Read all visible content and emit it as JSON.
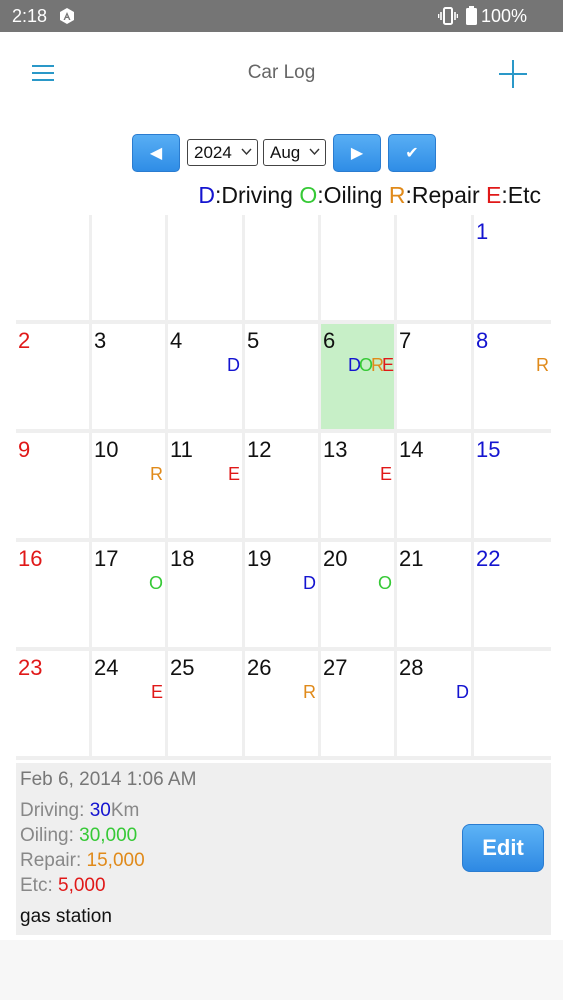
{
  "status_bar": {
    "time": "2:18",
    "battery": "100%"
  },
  "app_bar": {
    "title": "Car Log",
    "menu_icon": "menu-icon",
    "add_icon": "add-icon"
  },
  "controls": {
    "prev_label": "◀",
    "next_label": "▶",
    "confirm_label": "✔",
    "year": "2024",
    "month": "Aug"
  },
  "legend": {
    "driving": {
      "key": "D",
      "text": ":Driving"
    },
    "oiling": {
      "key": "O",
      "text": ":Oiling"
    },
    "repair": {
      "key": "R",
      "text": ":Repair"
    },
    "etc": {
      "key": "E",
      "text": ":Etc"
    }
  },
  "colors": {
    "driving": "#1414d0",
    "oiling": "#36c936",
    "repair": "#e08a1a",
    "etc": "#e01818",
    "saturday": "#1414d0",
    "sunday": "#e01818",
    "selected": "#c7efc7"
  },
  "calendar": {
    "weeks": [
      [
        {
          "day": ""
        },
        {
          "day": ""
        },
        {
          "day": ""
        },
        {
          "day": ""
        },
        {
          "day": ""
        },
        {
          "day": ""
        },
        {
          "day": "1",
          "marks": []
        }
      ],
      [
        {
          "day": "2",
          "marks": []
        },
        {
          "day": "3",
          "marks": []
        },
        {
          "day": "4",
          "marks": [
            "D"
          ]
        },
        {
          "day": "5",
          "marks": []
        },
        {
          "day": "6",
          "marks": [
            "D",
            "O",
            "R",
            "E"
          ],
          "selected": true
        },
        {
          "day": "7",
          "marks": []
        },
        {
          "day": "8",
          "marks": [
            "R"
          ]
        }
      ],
      [
        {
          "day": "9",
          "marks": []
        },
        {
          "day": "10",
          "marks": [
            "R"
          ]
        },
        {
          "day": "11",
          "marks": [
            "E"
          ]
        },
        {
          "day": "12",
          "marks": []
        },
        {
          "day": "13",
          "marks": [
            "E"
          ]
        },
        {
          "day": "14",
          "marks": []
        },
        {
          "day": "15",
          "marks": []
        }
      ],
      [
        {
          "day": "16",
          "marks": []
        },
        {
          "day": "17",
          "marks": [
            "O"
          ]
        },
        {
          "day": "18",
          "marks": []
        },
        {
          "day": "19",
          "marks": [
            "D"
          ]
        },
        {
          "day": "20",
          "marks": [
            "O"
          ]
        },
        {
          "day": "21",
          "marks": []
        },
        {
          "day": "22",
          "marks": []
        }
      ],
      [
        {
          "day": "23",
          "marks": []
        },
        {
          "day": "24",
          "marks": [
            "E"
          ]
        },
        {
          "day": "25",
          "marks": []
        },
        {
          "day": "26",
          "marks": [
            "R"
          ]
        },
        {
          "day": "27",
          "marks": []
        },
        {
          "day": "28",
          "marks": [
            "D"
          ]
        },
        {
          "day": ""
        }
      ]
    ]
  },
  "detail": {
    "datetime": "Feb 6, 2014 1:06 AM",
    "driving": {
      "label": "Driving: ",
      "value": "30",
      "unit": "Km"
    },
    "oiling": {
      "label": "Oiling: ",
      "value": "30,000"
    },
    "repair": {
      "label": "Repair: ",
      "value": "15,000"
    },
    "etc": {
      "label": "Etc: ",
      "value": "5,000"
    },
    "note": "gas station",
    "edit_label": "Edit"
  }
}
